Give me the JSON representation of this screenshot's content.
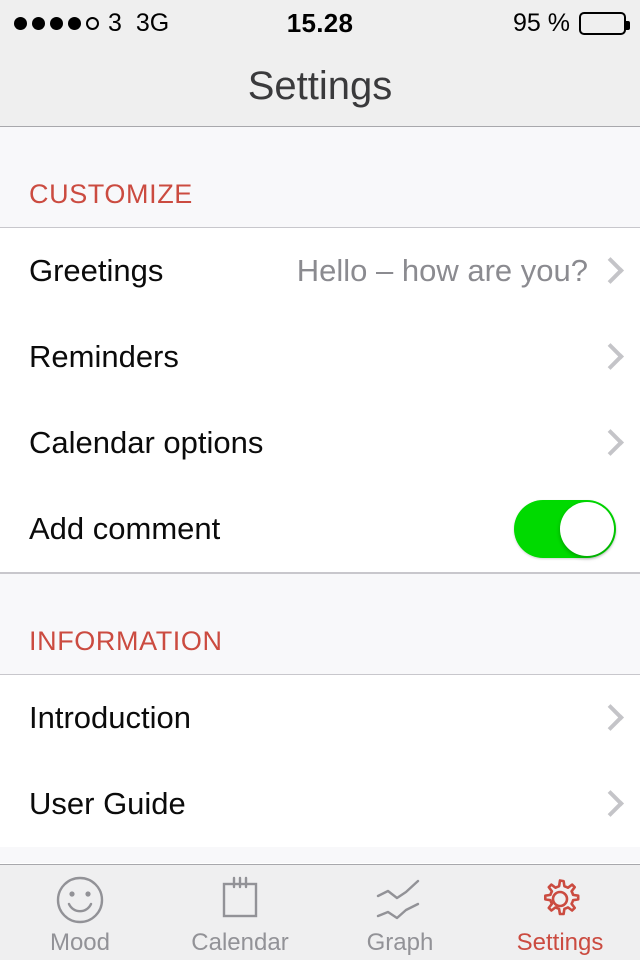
{
  "status_bar": {
    "signal_dots_filled": 4,
    "signal_dots_total": 5,
    "carrier": "3",
    "network": "3G",
    "time": "15.28",
    "battery_percent": "95 %",
    "battery_level": 100
  },
  "nav": {
    "title": "Settings"
  },
  "sections": [
    {
      "header": "CUSTOMIZE",
      "rows": [
        {
          "label": "Greetings",
          "detail": "Hello – how are you?",
          "accessory": "chevron"
        },
        {
          "label": "Reminders",
          "detail": "",
          "accessory": "chevron"
        },
        {
          "label": "Calendar options",
          "detail": "",
          "accessory": "chevron"
        },
        {
          "label": "Add comment",
          "detail": "",
          "accessory": "toggle",
          "toggle_on": true
        }
      ]
    },
    {
      "header": "INFORMATION",
      "rows": [
        {
          "label": "Introduction",
          "detail": "",
          "accessory": "chevron"
        },
        {
          "label": "User Guide",
          "detail": "",
          "accessory": "chevron"
        }
      ]
    }
  ],
  "tab_bar": {
    "items": [
      {
        "label": "Mood",
        "icon": "smiley-face-icon",
        "active": false
      },
      {
        "label": "Calendar",
        "icon": "calendar-icon",
        "active": false
      },
      {
        "label": "Graph",
        "icon": "line-graph-icon",
        "active": false
      },
      {
        "label": "Settings",
        "icon": "gear-icon",
        "active": true
      }
    ]
  },
  "colors": {
    "accent_red": "#cb4b40",
    "toggle_green": "#00da00",
    "inactive_gray": "#929297",
    "chevron_gray": "#c4c4c8",
    "nav_background": "#efefef",
    "section_background": "#f8f8fa"
  }
}
